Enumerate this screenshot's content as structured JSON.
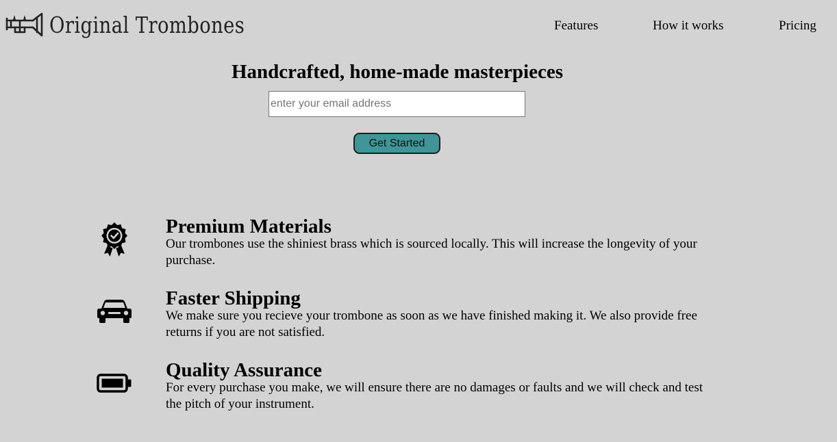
{
  "brand": {
    "name": "Original Trombones",
    "logo_icon": "trombone-icon"
  },
  "nav": {
    "items": [
      {
        "label": "Features"
      },
      {
        "label": "How it works"
      },
      {
        "label": "Pricing"
      }
    ]
  },
  "hero": {
    "title": "Handcrafted, home-made masterpieces",
    "email_placeholder": "enter your email address",
    "cta_label": "Get Started",
    "cta_color": "#3f9598"
  },
  "features": [
    {
      "icon": "award-badge-icon",
      "title": "Premium Materials",
      "description": "Our trombones use the shiniest brass which is sourced locally. This will increase the longevity of your purchase."
    },
    {
      "icon": "car-icon",
      "title": "Faster Shipping",
      "description": "We make sure you recieve your trombone as soon as we have finished making it. We also provide free returns if you are not satisfied."
    },
    {
      "icon": "battery-full-icon",
      "title": "Quality Assurance",
      "description": "For every purchase you make, we will ensure there are no damages or faults and we will check and test the pitch of your instrument."
    }
  ],
  "colors": {
    "background": "#d3d3d3",
    "button": "#3f9598"
  }
}
